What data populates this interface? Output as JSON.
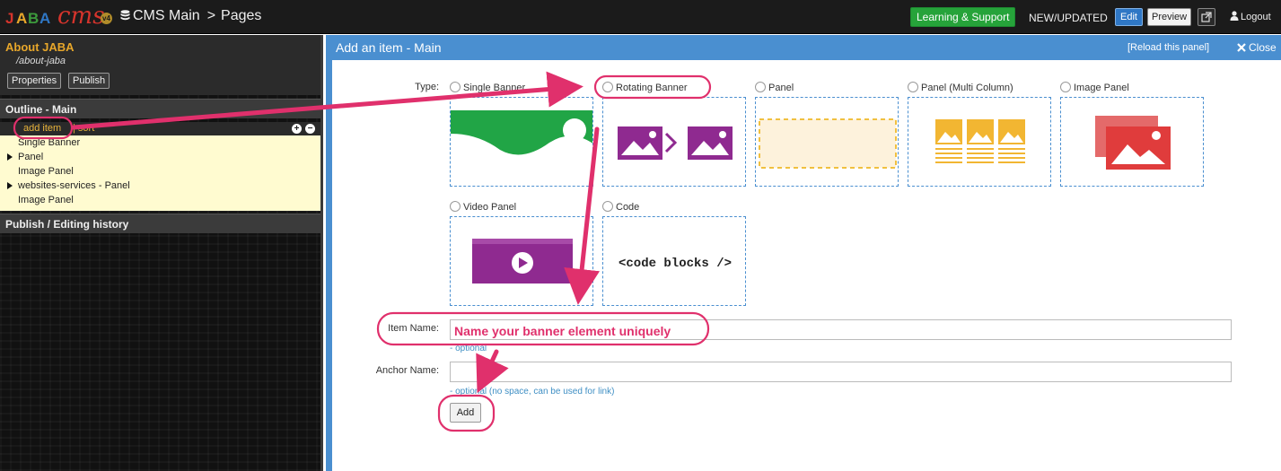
{
  "topbar": {
    "logo_text": "JABA",
    "logo_script": "cms",
    "logo_version": "v4",
    "site_name": "CMS Main",
    "section": "Pages",
    "learning_label": "Learning & Support",
    "new_updated_label": "NEW/UPDATED",
    "edit_label": "Edit",
    "preview_label": "Preview",
    "logout_label": "Logout"
  },
  "sidebar": {
    "page_title": "About JABA",
    "page_path": "/about-jaba",
    "properties_label": "Properties",
    "publish_label": "Publish",
    "outline_heading": "Outline - Main",
    "add_item_label": "add item",
    "sort_label": "| sort",
    "outline_items": [
      {
        "label": "Single Banner",
        "expandable": false
      },
      {
        "label": "Panel",
        "expandable": true
      },
      {
        "label": "Image Panel",
        "expandable": false
      },
      {
        "label": "websites-services - Panel",
        "expandable": true
      },
      {
        "label": "Image Panel",
        "expandable": false
      }
    ],
    "history_heading": "Publish / Editing history"
  },
  "panel": {
    "title": "Add an item - Main",
    "reload_label": "[Reload this panel]",
    "close_label": "Close",
    "type_label": "Type:",
    "types": [
      {
        "label": "Single Banner",
        "preview": "single-banner"
      },
      {
        "label": "Rotating Banner",
        "preview": "rotating-banner"
      },
      {
        "label": "Panel",
        "preview": "panel"
      },
      {
        "label": "Panel (Multi Column)",
        "preview": "panel-multi-column"
      },
      {
        "label": "Image Panel",
        "preview": "image-panel"
      },
      {
        "label": "Video Panel",
        "preview": "video-panel"
      },
      {
        "label": "Code",
        "preview": "code",
        "preview_text": "<code blocks />"
      }
    ],
    "item_name_label": "Item Name:",
    "item_name_value": "",
    "item_name_hint": "- optional",
    "anchor_name_label": "Anchor Name:",
    "anchor_name_value": "",
    "anchor_name_hint": "- optional (no space, can be used for link)",
    "add_button_label": "Add"
  },
  "annotation": {
    "callout_text": "Name your banner element uniquely",
    "color": "#e0306c"
  },
  "colors": {
    "accent_blue": "#4a8fd0",
    "sidebar_highlight": "#fffbd0",
    "learning_green": "#26a33a",
    "title_orange": "#e8a72a"
  }
}
